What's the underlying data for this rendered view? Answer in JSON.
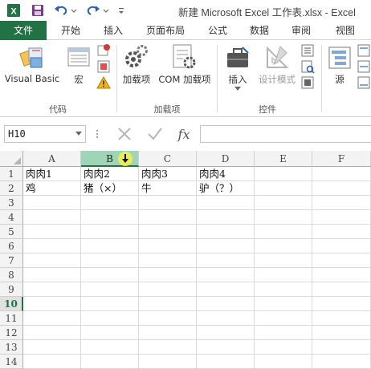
{
  "window": {
    "title": "新建 Microsoft Excel 工作表.xlsx - Excel",
    "qat": [
      "excel-logo-icon",
      "save-icon",
      "undo-icon",
      "redo-icon",
      "customize-qat-icon"
    ]
  },
  "tabs": [
    {
      "label": "文件"
    },
    {
      "label": "开始"
    },
    {
      "label": "插入"
    },
    {
      "label": "页面布局"
    },
    {
      "label": "公式"
    },
    {
      "label": "数据"
    },
    {
      "label": "审阅"
    },
    {
      "label": "视图"
    }
  ],
  "ribbon": {
    "code_group": {
      "label": "代码",
      "visual_basic": "Visual Basic",
      "macro": "宏"
    },
    "addins_group": {
      "label": "加载项",
      "addins": "加载项",
      "com_addins": "COM 加载项"
    },
    "controls_group": {
      "label": "控件",
      "insert": "插入",
      "design_mode": "设计模式"
    },
    "xml_group": {
      "source": "源"
    }
  },
  "formula_bar": {
    "name_box": "H10",
    "formula": ""
  },
  "grid": {
    "columns": [
      "A",
      "B",
      "C",
      "D",
      "E",
      "F"
    ],
    "selected_column": "B",
    "rows": [
      "1",
      "2",
      "3",
      "4",
      "5",
      "6",
      "7",
      "8",
      "9",
      "10",
      "11",
      "12",
      "13",
      "14"
    ],
    "selected_row": "10",
    "cells": {
      "A1": "肉肉1",
      "B1": "肉肉2",
      "C1": "肉肉3",
      "D1": "肉肉4",
      "A2": "鸡",
      "B2": "猪（×）",
      "C2": "牛",
      "D2": "驴（？）"
    }
  },
  "colors": {
    "accent": "#217346",
    "selected_header": "#9fd5b7"
  }
}
